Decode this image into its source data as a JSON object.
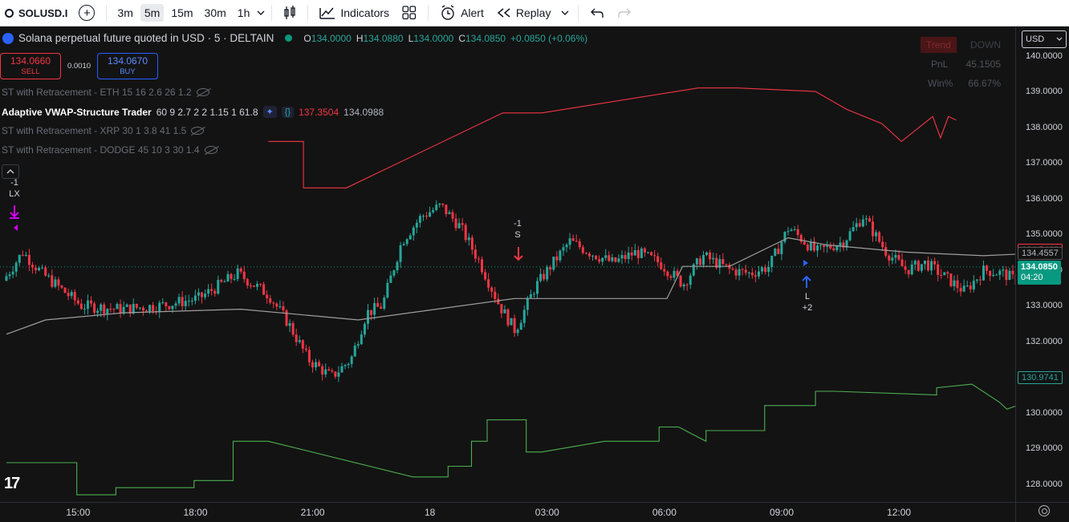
{
  "toolbar": {
    "symbol": "SOLUSD.I",
    "timeframes": [
      "3m",
      "5m",
      "15m",
      "30m",
      "1h"
    ],
    "active_timeframe": "5m",
    "indicators_label": "Indicators",
    "alert_label": "Alert",
    "replay_label": "Replay"
  },
  "legend": {
    "title": "Solana perpetual future quoted in USD · 5 · DELTAIN",
    "o_key": "O",
    "o_val": "134.0000",
    "h_key": "H",
    "h_val": "134.0880",
    "l_key": "L",
    "l_val": "134.0000",
    "c_key": "C",
    "c_val": "134.0850",
    "change": "+0.0850 (+0.06%)"
  },
  "trade": {
    "sell_price": "134.0660",
    "sell_label": "SELL",
    "spread": "0.0010",
    "buy_price": "134.0670",
    "buy_label": "BUY"
  },
  "indicators": [
    {
      "name": "ST with Retracement - ETH 15 16 2.6 26 1.2",
      "active": false
    },
    {
      "name": "Adaptive VWAP-Structure Trader",
      "params": "60 9 2.7 2 2 1.15 1 61.8",
      "value1": "137.3504",
      "value2": "134.0988",
      "active": true
    },
    {
      "name": "ST with Retracement - XRP 30 1 3.8 41 1.5",
      "active": false
    },
    {
      "name": "ST with Retracement - DODGE 45 10 3 30 1.4",
      "active": false
    }
  ],
  "stats": {
    "trend_label": "Trend",
    "trend_value": "DOWN",
    "pnl_label": "PnL",
    "pnl_value": "45.1505",
    "win_label": "Win%",
    "win_value": "66.67%"
  },
  "price_axis": {
    "currency": "USD",
    "ticks": [
      "140.0000",
      "139.0000",
      "138.0000",
      "137.0000",
      "136.0000",
      "135.0000",
      "134.0000",
      "133.0000",
      "132.0000",
      "131.0000",
      "130.0000",
      "129.0000",
      "128.0000"
    ],
    "labels": {
      "red": "134.5460",
      "grey": "134.4557",
      "current": "134.0850",
      "countdown": "04:20",
      "green": "130.9741"
    }
  },
  "time_axis": [
    "15:00",
    "18:00",
    "21:00",
    "18",
    "03:00",
    "06:00",
    "09:00",
    "12:00"
  ],
  "markers": {
    "lx_count": "-1",
    "lx_label": "LX",
    "s_count": "-1",
    "s_label": "S",
    "l_label": "L",
    "l_count": "+2"
  },
  "colors": {
    "up": "#26a69a",
    "down": "#f23645",
    "bg": "#131313",
    "stop_up": "#4caf50",
    "stop_down": "#f23645",
    "vwap": "#9e9e9e"
  },
  "chart_data": {
    "type": "candlestick",
    "y_range": [
      127.5,
      140.8
    ],
    "anchors_hours": [
      [
        0,
        133.7
      ],
      [
        0.5,
        134.5
      ],
      [
        1,
        133.9
      ],
      [
        2,
        133.0
      ],
      [
        3,
        132.9
      ],
      [
        4,
        133.0
      ],
      [
        5,
        133.2
      ],
      [
        6,
        133.9
      ],
      [
        6.8,
        133.3
      ],
      [
        7.3,
        132.5
      ],
      [
        7.8,
        131.5
      ],
      [
        8.4,
        131.0
      ],
      [
        8.9,
        131.5
      ],
      [
        9.3,
        132.8
      ],
      [
        9.7,
        133.0
      ],
      [
        10.2,
        134.8
      ],
      [
        10.7,
        135.5
      ],
      [
        11.2,
        135.8
      ],
      [
        11.7,
        135.2
      ],
      [
        12.2,
        134.2
      ],
      [
        12.7,
        133.0
      ],
      [
        13.1,
        132.3
      ],
      [
        13.6,
        133.5
      ],
      [
        14.0,
        134.1
      ],
      [
        14.5,
        134.8
      ],
      [
        15.0,
        134.5
      ],
      [
        15.6,
        134.2
      ],
      [
        16.2,
        134.5
      ],
      [
        16.8,
        134.2
      ],
      [
        17.4,
        133.6
      ],
      [
        17.9,
        134.4
      ],
      [
        18.6,
        134.0
      ],
      [
        19.1,
        133.9
      ],
      [
        19.6,
        134.1
      ],
      [
        20.1,
        135.2
      ],
      [
        20.8,
        134.5
      ],
      [
        21.5,
        134.8
      ],
      [
        22.0,
        135.5
      ],
      [
        22.6,
        134.5
      ],
      [
        23.1,
        134.0
      ],
      [
        23.6,
        134.2
      ],
      [
        24.1,
        133.8
      ],
      [
        24.6,
        133.4
      ],
      [
        25.1,
        134.0
      ],
      [
        25.6,
        133.9
      ],
      [
        26.1,
        133.6
      ],
      [
        26.6,
        134.3
      ],
      [
        27.1,
        134.9
      ],
      [
        27.8,
        135.0
      ],
      [
        28.4,
        134.8
      ]
    ],
    "vwap": [
      [
        0,
        132.2
      ],
      [
        1,
        132.6
      ],
      [
        3,
        132.8
      ],
      [
        6,
        132.9
      ],
      [
        8,
        132.7
      ],
      [
        9,
        132.6
      ],
      [
        11,
        132.9
      ],
      [
        13,
        133.2
      ],
      [
        16.9,
        133.2
      ],
      [
        17.3,
        134.1
      ],
      [
        18.5,
        134.1
      ],
      [
        20,
        134.9
      ],
      [
        21,
        134.7
      ],
      [
        23,
        134.5
      ],
      [
        25,
        134.4
      ],
      [
        27,
        134.5
      ],
      [
        28.4,
        134.4
      ]
    ],
    "stop_green": [
      [
        0,
        128.6
      ],
      [
        1.8,
        128.6
      ],
      [
        1.8,
        127.7
      ],
      [
        2.8,
        127.7
      ],
      [
        2.8,
        127.9
      ],
      [
        4.8,
        127.9
      ],
      [
        4.8,
        128.1
      ],
      [
        5.8,
        128.1
      ],
      [
        5.8,
        129.2
      ],
      [
        6.7,
        129.2
      ],
      [
        10.4,
        128.2
      ],
      [
        11.3,
        128.2
      ],
      [
        11.3,
        128.5
      ],
      [
        11.9,
        128.5
      ],
      [
        11.9,
        129.2
      ],
      [
        12.3,
        129.2
      ],
      [
        12.3,
        129.8
      ],
      [
        13.3,
        129.8
      ],
      [
        13.3,
        128.9
      ],
      [
        13.7,
        128.9
      ],
      [
        15.3,
        129.2
      ],
      [
        15.3,
        129.2
      ],
      [
        16.7,
        129.2
      ],
      [
        16.7,
        129.6
      ],
      [
        17.2,
        129.6
      ],
      [
        17.9,
        129.2
      ],
      [
        17.9,
        129.5
      ],
      [
        19.4,
        129.5
      ],
      [
        19.4,
        130.2
      ],
      [
        20.7,
        130.2
      ],
      [
        20.7,
        130.6
      ],
      [
        21.2,
        130.6
      ],
      [
        23.8,
        130.5
      ],
      [
        23.8,
        130.7
      ],
      [
        24.7,
        130.8
      ],
      [
        25.4,
        130.3
      ],
      [
        25.6,
        130.1
      ],
      [
        26.6,
        130.5
      ],
      [
        27.4,
        130.9
      ],
      [
        28.4,
        130.9
      ]
    ],
    "stop_red": [
      [
        6.7,
        137.6
      ],
      [
        7.6,
        137.6
      ],
      [
        7.6,
        136.3
      ],
      [
        8.7,
        136.3
      ],
      [
        8.7,
        136.3
      ],
      [
        12.7,
        138.4
      ],
      [
        13.7,
        138.4
      ],
      [
        17.7,
        139.1
      ],
      [
        18.7,
        139.1
      ],
      [
        20.7,
        139.0
      ],
      [
        21.5,
        138.5
      ],
      [
        22.4,
        138.1
      ],
      [
        22.9,
        137.6
      ],
      [
        23.7,
        138.3
      ],
      [
        23.9,
        137.7
      ],
      [
        24.1,
        138.3
      ],
      [
        24.3,
        138.2
      ]
    ]
  }
}
